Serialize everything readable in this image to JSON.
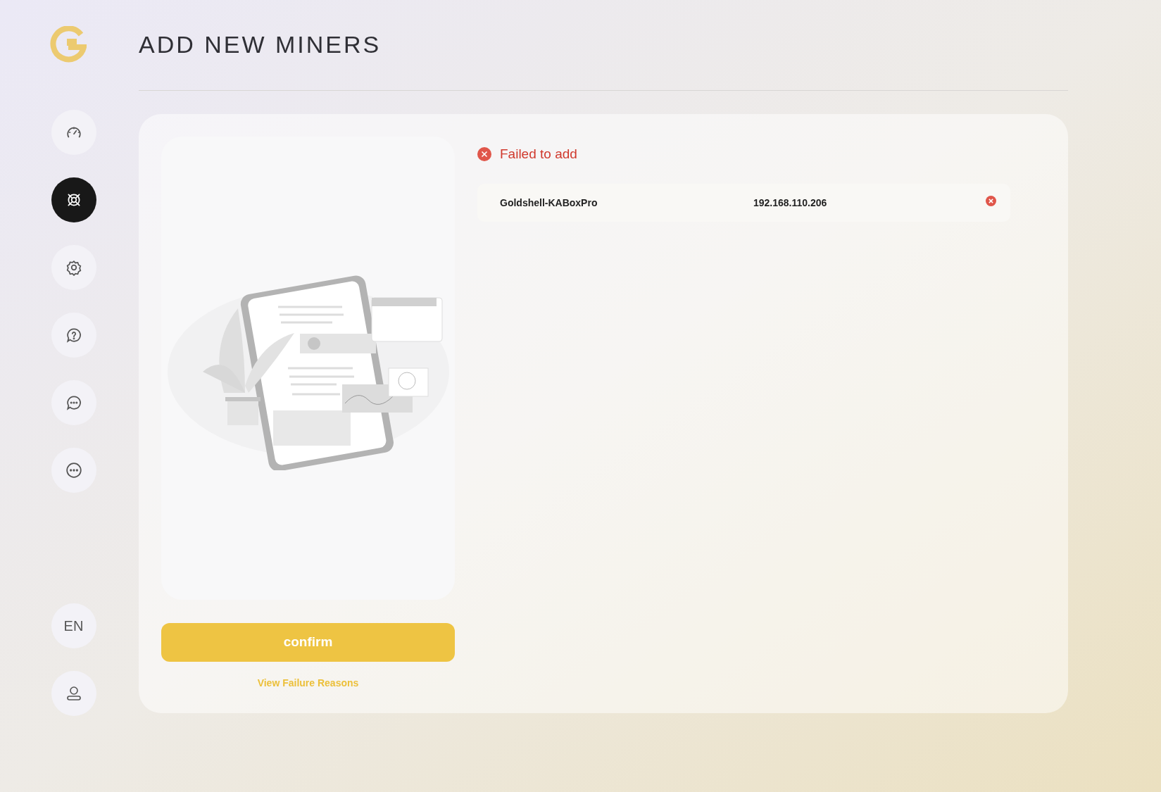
{
  "page": {
    "title": "ADD NEW MINERS"
  },
  "sidebar": {
    "items": [
      {
        "kind": "gauge",
        "selected": false
      },
      {
        "kind": "miner",
        "selected": true
      },
      {
        "kind": "settings",
        "selected": false
      },
      {
        "kind": "help",
        "selected": false
      },
      {
        "kind": "chat",
        "selected": false
      },
      {
        "kind": "more",
        "selected": false
      }
    ],
    "language": "EN"
  },
  "result": {
    "status": "Failed to add",
    "failed": [
      {
        "name": "Goldshell-KABoxPro",
        "ip": "192.168.110.206"
      }
    ]
  },
  "confirm_button": "confirm",
  "failure_link": "View Failure Reasons"
}
